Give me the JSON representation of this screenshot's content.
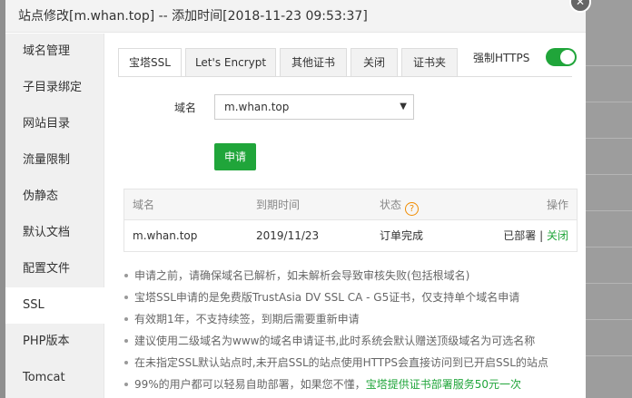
{
  "dialog": {
    "title": "站点修改[m.whan.top] -- 添加时间[2018-11-23 09:53:37]",
    "close_glyph": "✕"
  },
  "menu": {
    "items": [
      {
        "label": "域名管理"
      },
      {
        "label": "子目录绑定"
      },
      {
        "label": "网站目录"
      },
      {
        "label": "流量限制"
      },
      {
        "label": "伪静态"
      },
      {
        "label": "默认文档"
      },
      {
        "label": "配置文件"
      },
      {
        "label": "SSL"
      },
      {
        "label": "PHP版本"
      },
      {
        "label": "Tomcat"
      }
    ],
    "active": "SSL"
  },
  "tabs": [
    {
      "label": "宝塔SSL"
    },
    {
      "label": "Let's Encrypt"
    },
    {
      "label": "其他证书"
    },
    {
      "label": "关闭"
    },
    {
      "label": "证书夹"
    }
  ],
  "https": {
    "label": "强制HTTPS",
    "enabled": true
  },
  "form": {
    "domain_label": "域名",
    "domain_value": "m.whan.top",
    "caret": "▼",
    "apply_label": "申请"
  },
  "table": {
    "headers": [
      "域名",
      "到期时间",
      "状态",
      "操作"
    ],
    "help_glyph": "?",
    "rows": [
      {
        "domain": "m.whan.top",
        "expire": "2019/11/23",
        "status": "订单完成",
        "deployed": "已部署",
        "separator": " | ",
        "close": "关闭"
      }
    ]
  },
  "notes": [
    {
      "text": "申请之前，请确保域名已解析，如未解析会导致审核失败(包括根域名)"
    },
    {
      "text": "宝塔SSL申请的是免费版TrustAsia DV SSL CA - G5证书，仅支持单个域名申请"
    },
    {
      "text": "有效期1年，不支持续签，到期后需要重新申请"
    },
    {
      "text": "建议使用二级域名为www的域名申请证书,此时系统会默认赠送顶级域名为可选名称"
    },
    {
      "text": "在未指定SSL默认站点时,未开启SSL的站点使用HTTPS会直接访问到已开启SSL的站点"
    },
    {
      "text": "99%的用户都可以轻易自助部署，如果您不懂，",
      "link": "宝塔提供证书部署服务50元一次"
    }
  ],
  "colors": {
    "accent": "#20a53a",
    "warning": "#f08c00"
  }
}
